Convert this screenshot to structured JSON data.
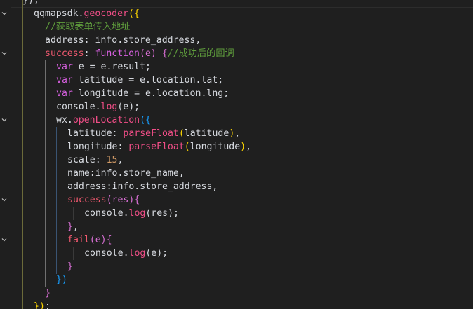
{
  "editor": {
    "lines": [
      {
        "indent": 32,
        "tokens": [
          {
            "t": "});",
            "c": "c-id"
          }
        ]
      },
      {
        "indent": 48,
        "tokens": [
          {
            "t": "qqmapsdk.",
            "c": "c-id"
          },
          {
            "t": "geocoder",
            "c": "c-meth"
          },
          {
            "t": "({",
            "c": "t-b1"
          }
        ]
      },
      {
        "indent": 64,
        "tokens": [
          {
            "t": "//获取表单传入地址",
            "c": "c-cmt"
          }
        ]
      },
      {
        "indent": 64,
        "tokens": [
          {
            "t": "address",
            "c": "c-id"
          },
          {
            "t": ": info.store_address,",
            "c": "c-id"
          }
        ]
      },
      {
        "indent": 64,
        "tokens": [
          {
            "t": "success",
            "c": "c-prop"
          },
          {
            "t": ": ",
            "c": "c-id"
          },
          {
            "t": "function",
            "c": "c-kw"
          },
          {
            "t": "(e) ",
            "c": "t-b2"
          },
          {
            "t": "{",
            "c": "t-b2"
          },
          {
            "t": "//成功后的回调",
            "c": "c-cmt"
          }
        ]
      },
      {
        "indent": 80,
        "tokens": [
          {
            "t": "var",
            "c": "c-kw"
          },
          {
            "t": " e = e.result;",
            "c": "c-id"
          }
        ]
      },
      {
        "indent": 80,
        "tokens": [
          {
            "t": "var",
            "c": "c-kw"
          },
          {
            "t": " latitude = e.location.lat;",
            "c": "c-id"
          }
        ]
      },
      {
        "indent": 80,
        "tokens": [
          {
            "t": "var",
            "c": "c-kw"
          },
          {
            "t": " longitude = e.location.lng;",
            "c": "c-id"
          }
        ]
      },
      {
        "indent": 80,
        "tokens": [
          {
            "t": "console.",
            "c": "c-id"
          },
          {
            "t": "log",
            "c": "c-meth"
          },
          {
            "t": "(e);",
            "c": "c-id"
          }
        ]
      },
      {
        "indent": 80,
        "tokens": [
          {
            "t": "wx.",
            "c": "c-id"
          },
          {
            "t": "openLocation",
            "c": "c-meth"
          },
          {
            "t": "({",
            "c": "t-b3"
          }
        ]
      },
      {
        "indent": 96,
        "tokens": [
          {
            "t": "latitude",
            "c": "c-id"
          },
          {
            "t": ": ",
            "c": "c-id"
          },
          {
            "t": "parseFloat",
            "c": "c-meth"
          },
          {
            "t": "(",
            "c": "t-b1"
          },
          {
            "t": "latitude",
            "c": "c-id"
          },
          {
            "t": ")",
            "c": "t-b1"
          },
          {
            "t": ",",
            "c": "c-id"
          }
        ]
      },
      {
        "indent": 96,
        "tokens": [
          {
            "t": "longitude",
            "c": "c-id"
          },
          {
            "t": ": ",
            "c": "c-id"
          },
          {
            "t": "parseFloat",
            "c": "c-meth"
          },
          {
            "t": "(",
            "c": "t-b1"
          },
          {
            "t": "longitude",
            "c": "c-id"
          },
          {
            "t": ")",
            "c": "t-b1"
          },
          {
            "t": ",",
            "c": "c-id"
          }
        ]
      },
      {
        "indent": 96,
        "tokens": [
          {
            "t": "scale",
            "c": "c-id"
          },
          {
            "t": ": ",
            "c": "c-id"
          },
          {
            "t": "15",
            "c": "c-num"
          },
          {
            "t": ",",
            "c": "c-id"
          }
        ]
      },
      {
        "indent": 96,
        "tokens": [
          {
            "t": "name",
            "c": "c-id"
          },
          {
            "t": ":info.store_name,",
            "c": "c-id"
          }
        ]
      },
      {
        "indent": 96,
        "tokens": [
          {
            "t": "address",
            "c": "c-id"
          },
          {
            "t": ":info.store_address,",
            "c": "c-id"
          }
        ]
      },
      {
        "indent": 96,
        "tokens": [
          {
            "t": "success",
            "c": "c-prop"
          },
          {
            "t": "(res)",
            "c": "t-b2"
          },
          {
            "t": "{",
            "c": "t-b2"
          }
        ]
      },
      {
        "indent": 120,
        "tokens": [
          {
            "t": "console.",
            "c": "c-id"
          },
          {
            "t": "log",
            "c": "c-meth"
          },
          {
            "t": "(res);",
            "c": "c-id"
          }
        ]
      },
      {
        "indent": 96,
        "tokens": [
          {
            "t": "}",
            "c": "t-b2"
          },
          {
            "t": ",",
            "c": "c-id"
          }
        ]
      },
      {
        "indent": 96,
        "tokens": [
          {
            "t": "fail",
            "c": "c-prop"
          },
          {
            "t": "(e)",
            "c": "t-b2"
          },
          {
            "t": "{",
            "c": "t-b2"
          }
        ]
      },
      {
        "indent": 120,
        "tokens": [
          {
            "t": "console.",
            "c": "c-id"
          },
          {
            "t": "log",
            "c": "c-meth"
          },
          {
            "t": "(e);",
            "c": "c-id"
          }
        ]
      },
      {
        "indent": 96,
        "tokens": [
          {
            "t": "}",
            "c": "t-b2"
          }
        ]
      },
      {
        "indent": 80,
        "tokens": [
          {
            "t": "})",
            "c": "t-b3"
          }
        ]
      },
      {
        "indent": 64,
        "tokens": [
          {
            "t": "}",
            "c": "t-b2"
          }
        ]
      },
      {
        "indent": 48,
        "tokens": [
          {
            "t": "})",
            "c": "t-b1"
          },
          {
            "t": ";",
            "c": "c-id"
          }
        ]
      }
    ],
    "fold_icon": "chevron-down-icon"
  }
}
